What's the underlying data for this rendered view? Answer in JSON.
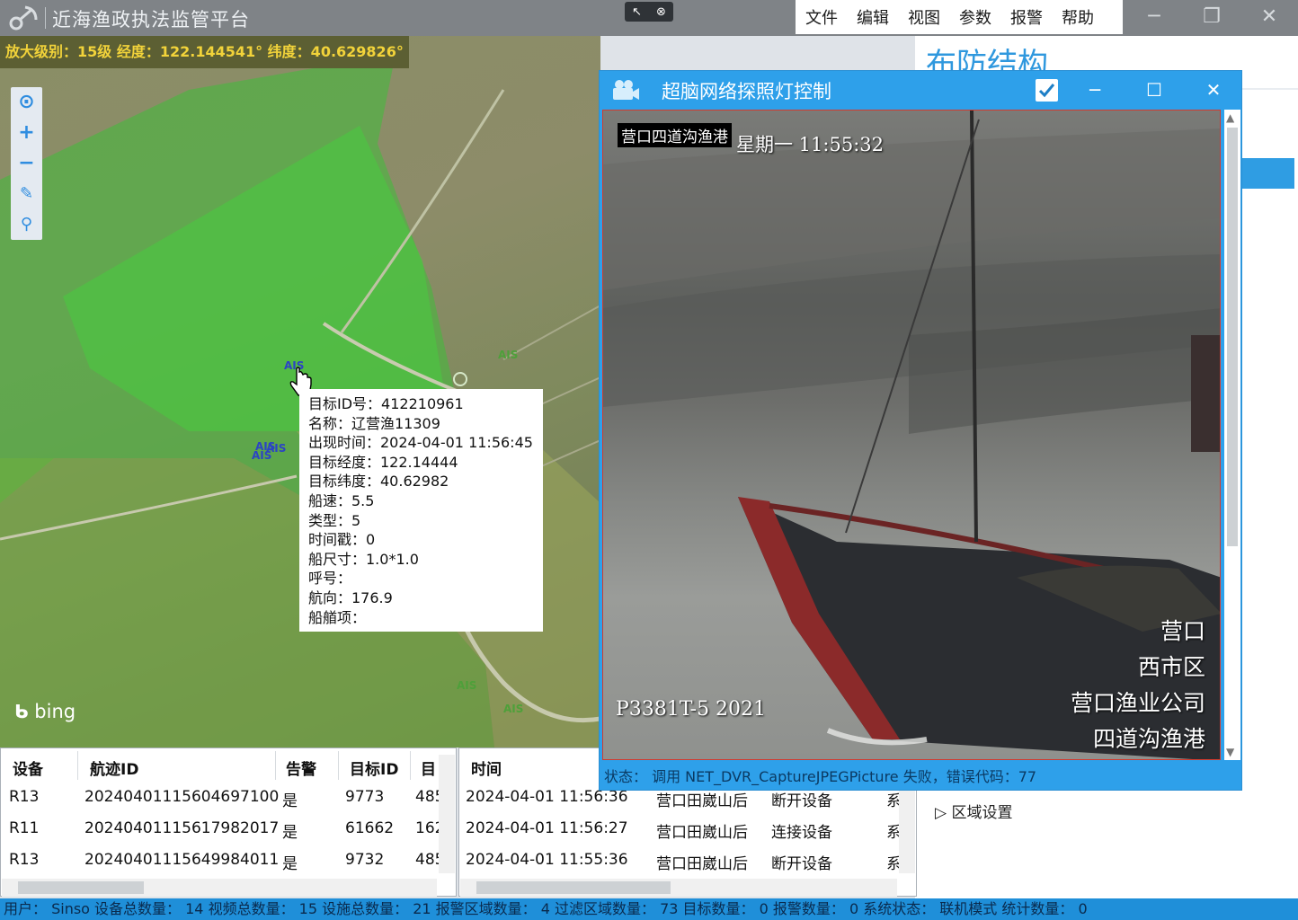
{
  "window": {
    "title": "近海渔政执法监管平台",
    "menu": [
      "文件",
      "编辑",
      "视图",
      "参数",
      "报警",
      "帮助"
    ]
  },
  "map": {
    "coord_bar": "放大级别：15级   经度：122.144541°   纬度：40.629826°",
    "attribution": "bing",
    "tools": [
      "locate-icon",
      "zoom-in-icon",
      "zoom-out-icon",
      "ruler-icon",
      "pin-icon"
    ],
    "marker_label": "AIS",
    "tooltip": [
      "目标ID号：412210961",
      "名称：辽营渔11309",
      "出现时间：2024-04-01 11:56:45",
      "目标经度：122.14444",
      "目标纬度：40.62982",
      "船速：5.5",
      "类型：5",
      "时间戳：0",
      "船尺寸：1.0*1.0",
      "呼号：",
      "航向：176.9",
      "船艏项："
    ]
  },
  "right_panel": {
    "title": "布防结构",
    "region_settings": "区域设置"
  },
  "dialog": {
    "title": "超脑网络探照灯控制",
    "video": {
      "location": "营口四道沟渔港",
      "time": "星期一 11:55:32",
      "hull_text": "P3381T-5   2021",
      "overlay_lines": [
        "营口",
        "西市区",
        "营口渔业公司",
        "四道沟渔港"
      ]
    },
    "status": "状态：  调用 NET_DVR_CaptureJPEGPicture 失败，错误代码：77"
  },
  "track_table": {
    "headers": [
      "设备",
      "航迹ID",
      "告警",
      "目标ID",
      "目"
    ],
    "rows": [
      [
        "R13",
        "20240401115604697100",
        "是",
        "9773",
        "485"
      ],
      [
        "R11",
        "20240401115617982017",
        "是",
        "61662",
        "162"
      ],
      [
        "R13",
        "20240401115649984011",
        "是",
        "9732",
        "485"
      ]
    ]
  },
  "event_table": {
    "headers": [
      "时间"
    ],
    "rows": [
      [
        "2024-04-01 11:56:36",
        "营口田崴山后",
        "断开设备",
        "系"
      ],
      [
        "2024-04-01 11:56:27",
        "营口田崴山后",
        "连接设备",
        "系"
      ],
      [
        "2024-04-01 11:55:36",
        "营口田崴山后",
        "断开设备",
        "系"
      ]
    ]
  },
  "statusbar": "用户： Sinso  设备总数量： 14  视频总数量： 15  设施总数量： 21  报警区域数量： 4  过滤区域数量： 73  目标数量： 0  报警数量： 0  系统状态： 联机模式  统计数量： 0",
  "colors": {
    "accent": "#2ea0ea",
    "coord_text": "#f2d33a",
    "status_bar": "#1f8fd9"
  }
}
